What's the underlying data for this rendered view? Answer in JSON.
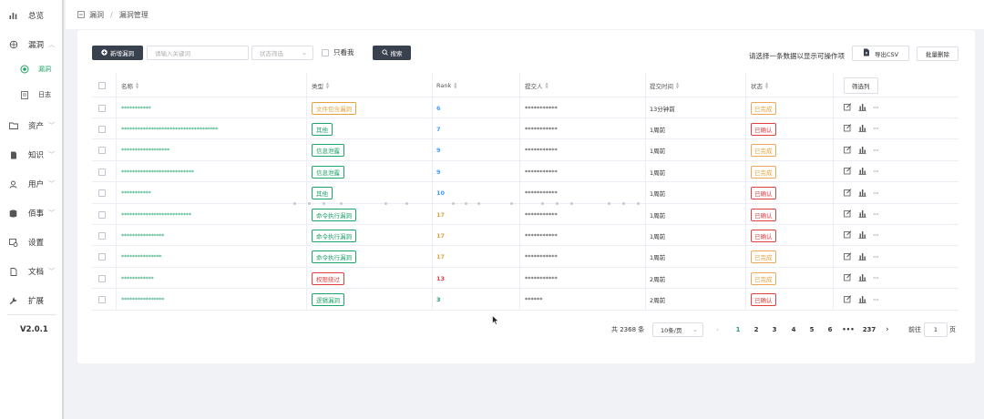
{
  "sidebar": {
    "items": [
      {
        "label": "总览",
        "icon": "bar-chart-icon",
        "chevron": false
      },
      {
        "label": "漏洞",
        "icon": "bug-icon",
        "chevron": true,
        "expanded": true
      },
      {
        "label": "漏洞",
        "icon": "vuln-icon",
        "sub": true,
        "active": true
      },
      {
        "label": "日志",
        "icon": "log-icon",
        "sub": true
      },
      {
        "label": "资产",
        "icon": "folder-icon",
        "chevron": true
      },
      {
        "label": "知识",
        "icon": "book-icon",
        "chevron": true
      },
      {
        "label": "用户",
        "icon": "user-icon",
        "chevron": true
      },
      {
        "label": "佰事",
        "icon": "database-icon",
        "chevron": true
      },
      {
        "label": "设置",
        "icon": "settings-icon",
        "chevron": false
      },
      {
        "label": "文档",
        "icon": "document-icon",
        "chevron": true
      },
      {
        "label": "扩展",
        "icon": "wrench-icon",
        "chevron": false
      }
    ],
    "version": "V2.0.1"
  },
  "breadcrumb": {
    "root": "漏洞",
    "current": "漏洞管理"
  },
  "toolbar": {
    "new_label": "新增漏洞",
    "keyword_placeholder": "请输入关键词",
    "status_placeholder": "状态筛选",
    "only_mine_label": "只看我",
    "search_label": "搜索",
    "hint": "请选择一条数据以显示可操作项",
    "export_label": "导出CSV",
    "batch_delete_label": "批量删除"
  },
  "table": {
    "headers": {
      "name": "名称",
      "type": "类型",
      "rank": "Rank",
      "submitter": "提交人",
      "time": "提交时间",
      "status": "状态",
      "filter": "筛选列"
    },
    "rows": [
      {
        "name": "***********",
        "type": "文件包含漏洞",
        "type_color": "orange",
        "rank": "6",
        "rank_color": "#409eff",
        "submitter": "***********",
        "time": "13分钟前",
        "status": "已完成",
        "status_color": "orange"
      },
      {
        "name": "************************************",
        "type": "其他",
        "type_color": "green",
        "rank": "7",
        "rank_color": "#409eff",
        "submitter": "***********",
        "time": "1周前",
        "status": "已确认",
        "status_color": "red"
      },
      {
        "name": "******************",
        "type": "信息泄露",
        "type_color": "green",
        "rank": "9",
        "rank_color": "#409eff",
        "submitter": "***********",
        "time": "1周前",
        "status": "已完成",
        "status_color": "orange"
      },
      {
        "name": "***************************",
        "type": "信息泄露",
        "type_color": "green",
        "rank": "9",
        "rank_color": "#409eff",
        "submitter": "***********",
        "time": "1周前",
        "status": "已完成",
        "status_color": "orange"
      },
      {
        "name": "***********",
        "type": "其他",
        "type_color": "green",
        "rank": "10",
        "rank_color": "#409eff",
        "submitter": "***********",
        "time": "1周前",
        "status": "已确认",
        "status_color": "red"
      },
      {
        "name": "**************************",
        "type": "命令执行漏洞",
        "type_color": "green",
        "rank": "17",
        "rank_color": "#e6a23c",
        "submitter": "***********",
        "time": "1周前",
        "status": "已确认",
        "status_color": "red"
      },
      {
        "name": "****************",
        "type": "命令执行漏洞",
        "type_color": "green",
        "rank": "17",
        "rank_color": "#e6a23c",
        "submitter": "***********",
        "time": "1周前",
        "status": "已确认",
        "status_color": "red"
      },
      {
        "name": "***************",
        "type": "命令执行漏洞",
        "type_color": "green",
        "rank": "17",
        "rank_color": "#e6a23c",
        "submitter": "***********",
        "time": "1周前",
        "status": "已完成",
        "status_color": "orange"
      },
      {
        "name": "************",
        "type": "权限绕过",
        "type_color": "red",
        "rank": "13",
        "rank_color": "#e04040",
        "submitter": "***********",
        "time": "2周前",
        "status": "已完成",
        "status_color": "orange"
      },
      {
        "name": "****************",
        "type": "逻辑漏洞",
        "type_color": "green",
        "rank": "3",
        "rank_color": "#20a36b",
        "submitter": "******",
        "time": "2周前",
        "status": "已确认",
        "status_color": "red"
      }
    ]
  },
  "pagination": {
    "total": "共 2368 条",
    "page_size": "10条/页",
    "pages": [
      "1",
      "2",
      "3",
      "4",
      "5",
      "6",
      "•••",
      "237"
    ],
    "goto_label": "前往",
    "goto_value": "1",
    "page_unit": "页"
  }
}
